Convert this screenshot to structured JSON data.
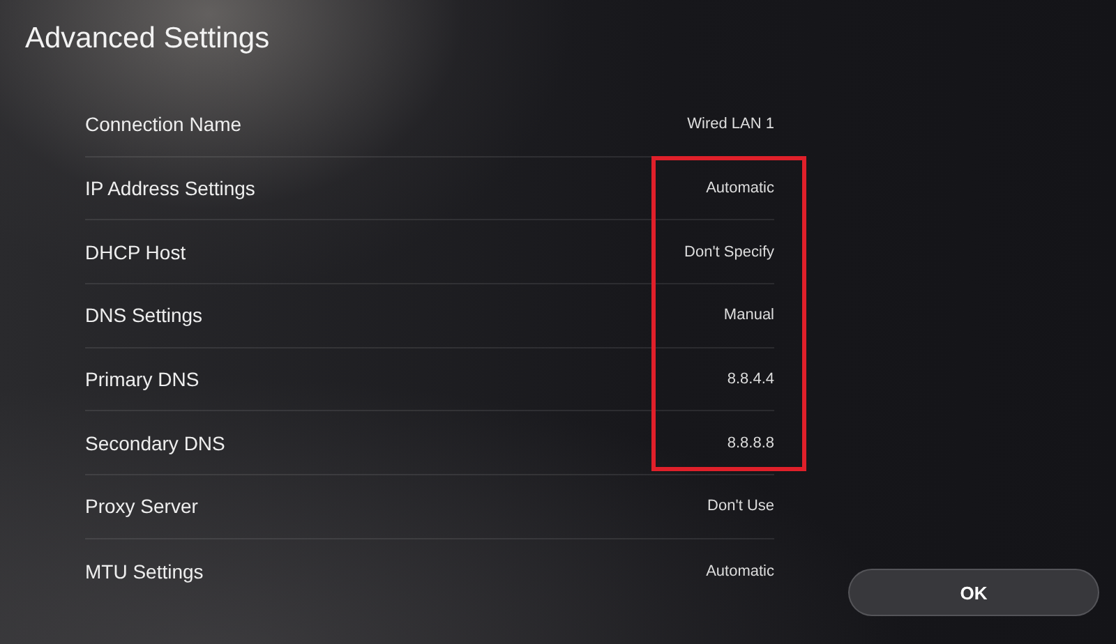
{
  "title": "Advanced Settings",
  "rows": [
    {
      "label": "Connection Name",
      "value": "Wired LAN 1",
      "highlighted": false
    },
    {
      "label": "IP Address Settings",
      "value": "Automatic",
      "highlighted": true
    },
    {
      "label": "DHCP Host",
      "value": "Don't Specify",
      "highlighted": true
    },
    {
      "label": "DNS Settings",
      "value": "Manual",
      "highlighted": true
    },
    {
      "label": "Primary DNS",
      "value": "8.8.4.4",
      "highlighted": true
    },
    {
      "label": "Secondary DNS",
      "value": "8.8.8.8",
      "highlighted": true
    },
    {
      "label": "Proxy Server",
      "value": "Don't Use",
      "highlighted": false
    },
    {
      "label": "MTU Settings",
      "value": "Automatic",
      "highlighted": false
    }
  ],
  "ok_button": "OK"
}
